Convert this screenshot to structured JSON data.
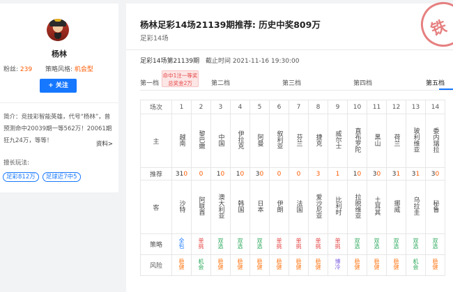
{
  "profile": {
    "name": "杨林",
    "fans_label": "粉丝:",
    "fans": "239",
    "style_label": "策略风格:",
    "style": "机会型",
    "follow_label": "+ 关注",
    "intro": "简介：竞技彩智能英雄，代号“杨林”，曾预测命中20039期一等562万！20061期狂九24万，等等！",
    "more_label": "资料>",
    "skill_title": "擅长玩法:",
    "tags": [
      "足彩812万",
      "足球近7中5"
    ]
  },
  "article": {
    "title": "杨林足彩14场21139期推荐: 历史中奖809万",
    "subtitle": "足彩14场",
    "issue": "足彩14场第21139期",
    "deadline": "截止时间  2021-11-16 19:30:00",
    "stamp_char": "铁",
    "tabs": [
      "第一档",
      "第二档",
      "第三档",
      "第四档",
      "第五档"
    ],
    "active_tab": "第五档",
    "badge_line1": "命中1注一等奖",
    "badge_line2": "总奖金2万"
  },
  "table": {
    "labels": {
      "match": "场次",
      "home": "主",
      "rec": "推荐",
      "away": "客",
      "strategy": "策略",
      "risk": "风险"
    },
    "matches": [
      {
        "no": "1",
        "home": "越南",
        "rec": [
          "3",
          "1",
          "0"
        ],
        "hit": [
          false,
          false,
          true
        ],
        "away": "沙特",
        "strategy": "全包",
        "risk": "稳健"
      },
      {
        "no": "2",
        "home": "黎巴嫩",
        "rec": [
          "0"
        ],
        "hit": [
          true
        ],
        "away": "阿联酋",
        "strategy": "单挑",
        "risk": "机会"
      },
      {
        "no": "3",
        "home": "中国",
        "rec": [
          "1",
          "0"
        ],
        "hit": [
          false,
          true
        ],
        "away": "澳大利亚",
        "strategy": "双选",
        "risk": "稳健"
      },
      {
        "no": "4",
        "home": "伊拉克",
        "rec": [
          "1",
          "0"
        ],
        "hit": [
          false,
          true
        ],
        "away": "韩国",
        "strategy": "双选",
        "risk": "稳健"
      },
      {
        "no": "5",
        "home": "阿曼",
        "rec": [
          "3",
          "0"
        ],
        "hit": [
          false,
          true
        ],
        "away": "日本",
        "strategy": "双选",
        "risk": "稳健"
      },
      {
        "no": "6",
        "home": "叙利亚",
        "rec": [
          "0"
        ],
        "hit": [
          true
        ],
        "away": "伊朗",
        "strategy": "单挑",
        "risk": "稳健"
      },
      {
        "no": "7",
        "home": "芬兰",
        "rec": [
          "0"
        ],
        "hit": [
          true
        ],
        "away": "法国",
        "strategy": "单挑",
        "risk": "稳健"
      },
      {
        "no": "8",
        "home": "捷克",
        "rec": [
          "3"
        ],
        "hit": [
          true
        ],
        "away": "爱沙尼亚",
        "strategy": "单挑",
        "risk": "稳健"
      },
      {
        "no": "9",
        "home": "威尔士",
        "rec": [
          "1"
        ],
        "hit": [
          true
        ],
        "away": "比利时",
        "strategy": "单挑",
        "risk": "博冷"
      },
      {
        "no": "10",
        "home": "直布罗陀",
        "rec": [
          "1",
          "0"
        ],
        "hit": [
          false,
          true
        ],
        "away": "拉脱维亚",
        "strategy": "双选",
        "risk": "稳健"
      },
      {
        "no": "11",
        "home": "黑山",
        "rec": [
          "3",
          "0"
        ],
        "hit": [
          false,
          true
        ],
        "away": "土耳其",
        "strategy": "双选",
        "risk": "稳健"
      },
      {
        "no": "12",
        "home": "荷兰",
        "rec": [
          "3",
          "1"
        ],
        "hit": [
          false,
          true
        ],
        "away": "挪威",
        "strategy": "双选",
        "risk": "稳健"
      },
      {
        "no": "13",
        "home": "玻利维亚",
        "rec": [
          "3",
          "1"
        ],
        "hit": [
          false,
          true
        ],
        "away": "乌拉圭",
        "strategy": "双选",
        "risk": "机会"
      },
      {
        "no": "14",
        "home": "委内瑞拉",
        "rec": [
          "3",
          "0"
        ],
        "hit": [
          false,
          true
        ],
        "away": "秘鲁",
        "strategy": "双选",
        "risk": "稳健"
      }
    ]
  },
  "colors": {
    "accent": "#1677ff",
    "hit": "#ff5a00",
    "strategy": {
      "全包": "#1677ff",
      "单挑": "#e54545",
      "双选": "#2aa85b"
    },
    "risk": {
      "稳健": "#ff7a1a",
      "机会": "#2aa85b",
      "博冷": "#7b5ce0"
    }
  }
}
